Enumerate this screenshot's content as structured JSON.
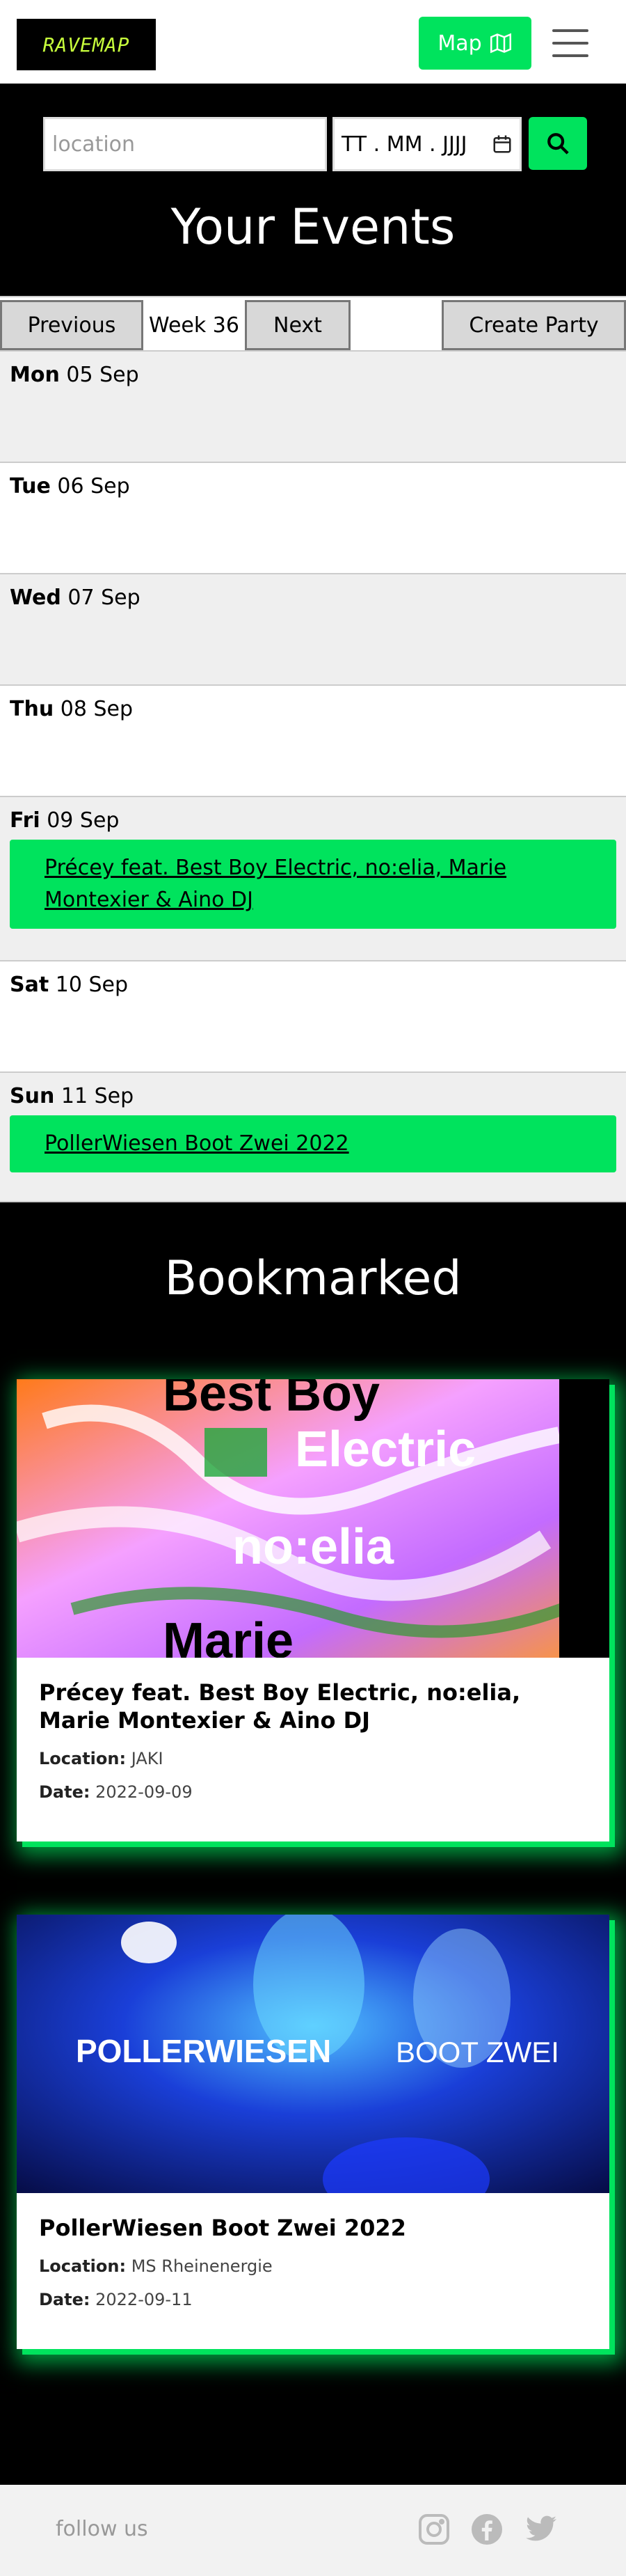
{
  "navbar": {
    "logo_text": "RAVEMAP",
    "map_label": "Map"
  },
  "search": {
    "location_placeholder": "location",
    "date_placeholder": "TT . MM . JJJJ"
  },
  "events": {
    "title": "Your Events"
  },
  "week": {
    "prev_label": "Previous",
    "current_label": "Week 36",
    "next_label": "Next",
    "create_label": "Create Party"
  },
  "days": [
    {
      "weekday": "Mon",
      "date": "05 Sep"
    },
    {
      "weekday": "Tue",
      "date": "06 Sep"
    },
    {
      "weekday": "Wed",
      "date": "07 Sep"
    },
    {
      "weekday": "Thu",
      "date": "08 Sep"
    },
    {
      "weekday": "Fri",
      "date": "09 Sep",
      "event": "Précey feat. Best Boy Electric, no:elia, Marie Montexier & Aino DJ"
    },
    {
      "weekday": "Sat",
      "date": "10 Sep"
    },
    {
      "weekday": "Sun",
      "date": "11 Sep",
      "event": "PollerWiesen Boot Zwei 2022"
    }
  ],
  "bookmarked": {
    "title": "Bookmarked",
    "cards": [
      {
        "title": "Précey feat. Best Boy Electric, no:elia, Marie Montexier & Aino DJ",
        "location_label": "Location:",
        "location": "JAKI",
        "date_label": "Date:",
        "date": "2022-09-09",
        "image_text": [
          "Best Boy",
          "Electric",
          "no:elia",
          "Marie"
        ]
      },
      {
        "title": "PollerWiesen Boot Zwei 2022",
        "location_label": "Location:",
        "location": "MS Rheinenergie",
        "date_label": "Date:",
        "date": "2022-09-11",
        "image_text": [
          "POLLERWIESEN",
          "BOOT ZWEI"
        ]
      }
    ]
  },
  "footer": {
    "follow_label": "follow us"
  },
  "colors": {
    "accent": "#00e35d",
    "logo": "#c7ff3c"
  }
}
